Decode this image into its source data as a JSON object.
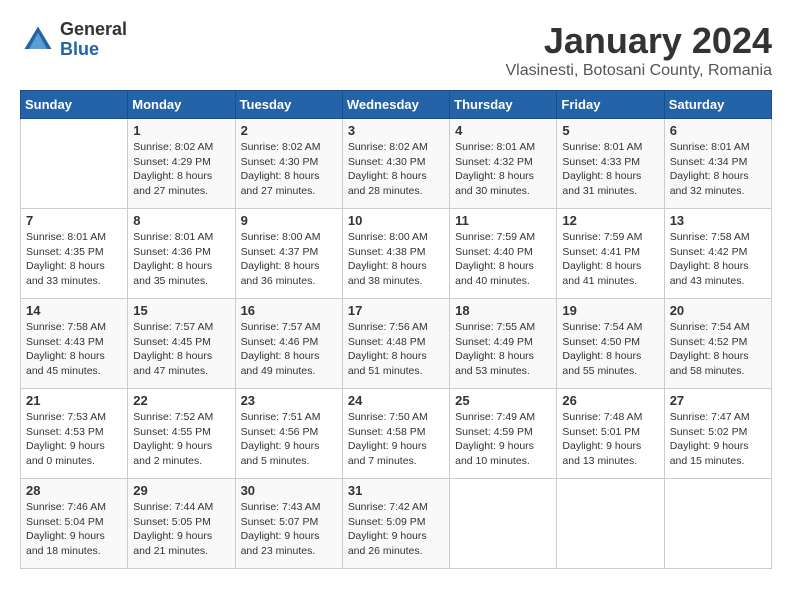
{
  "logo": {
    "general": "General",
    "blue": "Blue"
  },
  "title": "January 2024",
  "location": "Vlasinesti, Botosani County, Romania",
  "weekdays": [
    "Sunday",
    "Monday",
    "Tuesday",
    "Wednesday",
    "Thursday",
    "Friday",
    "Saturday"
  ],
  "weeks": [
    [
      {
        "day": "",
        "info": ""
      },
      {
        "day": "1",
        "info": "Sunrise: 8:02 AM\nSunset: 4:29 PM\nDaylight: 8 hours\nand 27 minutes."
      },
      {
        "day": "2",
        "info": "Sunrise: 8:02 AM\nSunset: 4:30 PM\nDaylight: 8 hours\nand 27 minutes."
      },
      {
        "day": "3",
        "info": "Sunrise: 8:02 AM\nSunset: 4:30 PM\nDaylight: 8 hours\nand 28 minutes."
      },
      {
        "day": "4",
        "info": "Sunrise: 8:01 AM\nSunset: 4:32 PM\nDaylight: 8 hours\nand 30 minutes."
      },
      {
        "day": "5",
        "info": "Sunrise: 8:01 AM\nSunset: 4:33 PM\nDaylight: 8 hours\nand 31 minutes."
      },
      {
        "day": "6",
        "info": "Sunrise: 8:01 AM\nSunset: 4:34 PM\nDaylight: 8 hours\nand 32 minutes."
      }
    ],
    [
      {
        "day": "7",
        "info": "Sunrise: 8:01 AM\nSunset: 4:35 PM\nDaylight: 8 hours\nand 33 minutes."
      },
      {
        "day": "8",
        "info": "Sunrise: 8:01 AM\nSunset: 4:36 PM\nDaylight: 8 hours\nand 35 minutes."
      },
      {
        "day": "9",
        "info": "Sunrise: 8:00 AM\nSunset: 4:37 PM\nDaylight: 8 hours\nand 36 minutes."
      },
      {
        "day": "10",
        "info": "Sunrise: 8:00 AM\nSunset: 4:38 PM\nDaylight: 8 hours\nand 38 minutes."
      },
      {
        "day": "11",
        "info": "Sunrise: 7:59 AM\nSunset: 4:40 PM\nDaylight: 8 hours\nand 40 minutes."
      },
      {
        "day": "12",
        "info": "Sunrise: 7:59 AM\nSunset: 4:41 PM\nDaylight: 8 hours\nand 41 minutes."
      },
      {
        "day": "13",
        "info": "Sunrise: 7:58 AM\nSunset: 4:42 PM\nDaylight: 8 hours\nand 43 minutes."
      }
    ],
    [
      {
        "day": "14",
        "info": "Sunrise: 7:58 AM\nSunset: 4:43 PM\nDaylight: 8 hours\nand 45 minutes."
      },
      {
        "day": "15",
        "info": "Sunrise: 7:57 AM\nSunset: 4:45 PM\nDaylight: 8 hours\nand 47 minutes."
      },
      {
        "day": "16",
        "info": "Sunrise: 7:57 AM\nSunset: 4:46 PM\nDaylight: 8 hours\nand 49 minutes."
      },
      {
        "day": "17",
        "info": "Sunrise: 7:56 AM\nSunset: 4:48 PM\nDaylight: 8 hours\nand 51 minutes."
      },
      {
        "day": "18",
        "info": "Sunrise: 7:55 AM\nSunset: 4:49 PM\nDaylight: 8 hours\nand 53 minutes."
      },
      {
        "day": "19",
        "info": "Sunrise: 7:54 AM\nSunset: 4:50 PM\nDaylight: 8 hours\nand 55 minutes."
      },
      {
        "day": "20",
        "info": "Sunrise: 7:54 AM\nSunset: 4:52 PM\nDaylight: 8 hours\nand 58 minutes."
      }
    ],
    [
      {
        "day": "21",
        "info": "Sunrise: 7:53 AM\nSunset: 4:53 PM\nDaylight: 9 hours\nand 0 minutes."
      },
      {
        "day": "22",
        "info": "Sunrise: 7:52 AM\nSunset: 4:55 PM\nDaylight: 9 hours\nand 2 minutes."
      },
      {
        "day": "23",
        "info": "Sunrise: 7:51 AM\nSunset: 4:56 PM\nDaylight: 9 hours\nand 5 minutes."
      },
      {
        "day": "24",
        "info": "Sunrise: 7:50 AM\nSunset: 4:58 PM\nDaylight: 9 hours\nand 7 minutes."
      },
      {
        "day": "25",
        "info": "Sunrise: 7:49 AM\nSunset: 4:59 PM\nDaylight: 9 hours\nand 10 minutes."
      },
      {
        "day": "26",
        "info": "Sunrise: 7:48 AM\nSunset: 5:01 PM\nDaylight: 9 hours\nand 13 minutes."
      },
      {
        "day": "27",
        "info": "Sunrise: 7:47 AM\nSunset: 5:02 PM\nDaylight: 9 hours\nand 15 minutes."
      }
    ],
    [
      {
        "day": "28",
        "info": "Sunrise: 7:46 AM\nSunset: 5:04 PM\nDaylight: 9 hours\nand 18 minutes."
      },
      {
        "day": "29",
        "info": "Sunrise: 7:44 AM\nSunset: 5:05 PM\nDaylight: 9 hours\nand 21 minutes."
      },
      {
        "day": "30",
        "info": "Sunrise: 7:43 AM\nSunset: 5:07 PM\nDaylight: 9 hours\nand 23 minutes."
      },
      {
        "day": "31",
        "info": "Sunrise: 7:42 AM\nSunset: 5:09 PM\nDaylight: 9 hours\nand 26 minutes."
      },
      {
        "day": "",
        "info": ""
      },
      {
        "day": "",
        "info": ""
      },
      {
        "day": "",
        "info": ""
      }
    ]
  ]
}
